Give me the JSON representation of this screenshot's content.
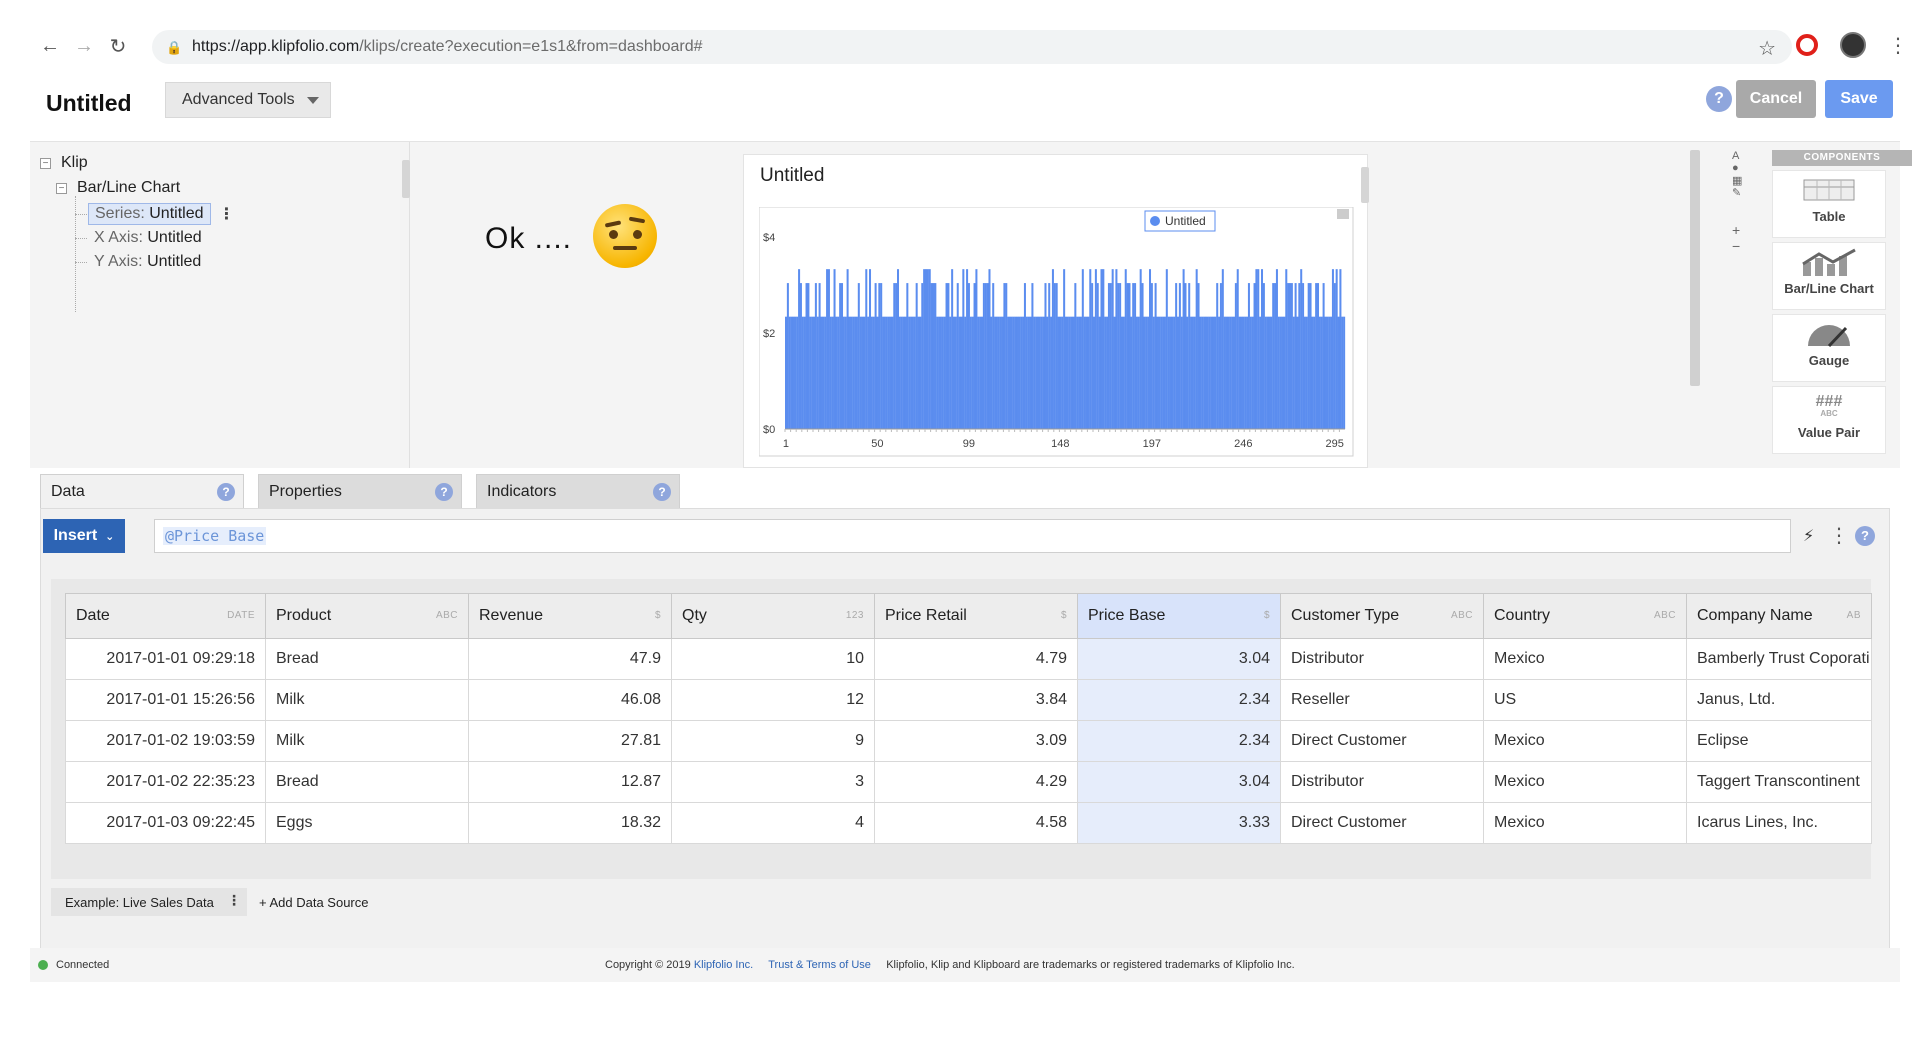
{
  "browser": {
    "url_host": "https://app.klipfolio.com",
    "url_path": "/klips/create?execution=e1s1&from=dashboard#"
  },
  "header": {
    "title": "Untitled",
    "advanced_tools": "Advanced Tools",
    "help": "?",
    "cancel": "Cancel",
    "save": "Save"
  },
  "tree": {
    "root": "Klip",
    "chart": "Bar/Line Chart",
    "series_prefix": "Series:",
    "series_name": "Untitled",
    "x_axis_prefix": "X Axis:",
    "x_axis_name": "Untitled",
    "y_axis_prefix": "Y Axis:",
    "y_axis_name": "Untitled"
  },
  "annotation": {
    "text": "Ok ...."
  },
  "chart_card": {
    "title": "Untitled"
  },
  "chart_data": {
    "type": "bar",
    "title": "Untitled",
    "legend": [
      "Untitled"
    ],
    "legend_position": "top-right",
    "series_color": "#5b8def",
    "x_ticks": [
      "1",
      "50",
      "99",
      "148",
      "197",
      "246",
      "295"
    ],
    "y_ticks": [
      "$0",
      "$2",
      "$4"
    ],
    "ylim": [
      0,
      4
    ],
    "x_count": 300,
    "value_levels": [
      2.34,
      3.04,
      3.33
    ],
    "grid": false
  },
  "components": {
    "header": "COMPONENTS",
    "items": [
      {
        "label": "Table",
        "icon": "table-icon"
      },
      {
        "label": "Bar/Line Chart",
        "icon": "bar-line-chart-icon"
      },
      {
        "label": "Gauge",
        "icon": "gauge-icon"
      },
      {
        "label": "Value Pair",
        "icon": "value-pair-icon",
        "icon_text": "###",
        "icon_sub": "ABC"
      }
    ]
  },
  "tabs": [
    {
      "label": "Data",
      "active": true
    },
    {
      "label": "Properties",
      "active": false
    },
    {
      "label": "Indicators",
      "active": false
    }
  ],
  "data_panel": {
    "insert_label": "Insert",
    "formula": "@Price Base"
  },
  "table": {
    "columns": [
      {
        "name": "Date",
        "type": "DATE"
      },
      {
        "name": "Product",
        "type": "ABC"
      },
      {
        "name": "Revenue",
        "type": "$"
      },
      {
        "name": "Qty",
        "type": "123"
      },
      {
        "name": "Price Retail",
        "type": "$"
      },
      {
        "name": "Price Base",
        "type": "$"
      },
      {
        "name": "Customer Type",
        "type": "ABC"
      },
      {
        "name": "Country",
        "type": "ABC"
      },
      {
        "name": "Company Name",
        "type": "AB"
      }
    ],
    "rows": [
      [
        "2017-01-01 09:29:18",
        "Bread",
        "47.9",
        "10",
        "4.79",
        "3.04",
        "Distributor",
        "Mexico",
        "Bamberly Trust Coporati"
      ],
      [
        "2017-01-01 15:26:56",
        "Milk",
        "46.08",
        "12",
        "3.84",
        "2.34",
        "Reseller",
        "US",
        "Janus, Ltd."
      ],
      [
        "2017-01-02 19:03:59",
        "Milk",
        "27.81",
        "9",
        "3.09",
        "2.34",
        "Direct Customer",
        "Mexico",
        "Eclipse"
      ],
      [
        "2017-01-02 22:35:23",
        "Bread",
        "12.87",
        "3",
        "4.29",
        "3.04",
        "Distributor",
        "Mexico",
        "Taggert Transcontinent"
      ],
      [
        "2017-01-03 09:22:45",
        "Eggs",
        "18.32",
        "4",
        "4.58",
        "3.33",
        "Direct Customer",
        "Mexico",
        "Icarus Lines, Inc."
      ]
    ]
  },
  "sources": {
    "active": "Example: Live Sales Data",
    "add": "+ Add Data Source"
  },
  "footer": {
    "status": "Connected",
    "copyright_prefix": "Copyright © 2019",
    "company_link": "Klipfolio Inc.",
    "terms_link": "Trust & Terms of Use",
    "trademark": "Klipfolio, Klip and Klipboard are trademarks or registered trademarks of Klipfolio Inc."
  }
}
